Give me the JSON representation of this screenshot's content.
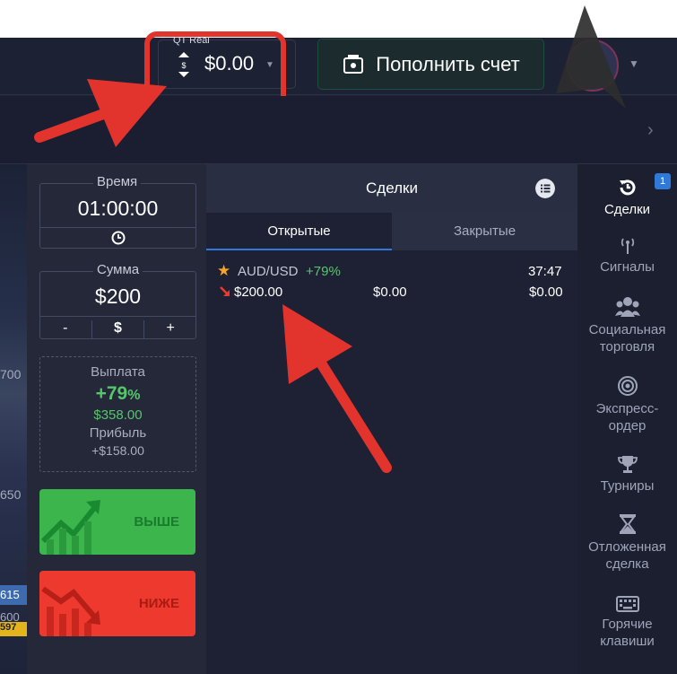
{
  "header": {
    "account_type": "QT Real",
    "balance": "$0.00",
    "deposit_label": "Пополнить счет"
  },
  "chart": {
    "price_labels": [
      "700",
      "650",
      "615",
      "600",
      "597"
    ]
  },
  "trade": {
    "time_label": "Время",
    "time_value": "01:00:00",
    "amount_label": "Сумма",
    "amount_value": "$200",
    "minus": "-",
    "currency": "$",
    "plus": "+",
    "payout_label": "Выплата",
    "payout_percent": "+79",
    "payout_percent_sign": "%",
    "payout_amount": "$358.00",
    "profit_label": "Прибыль",
    "profit_amount": "+$158.00",
    "up_label": "ВЫШЕ",
    "down_label": "НИЖЕ"
  },
  "deals": {
    "title": "Сделки",
    "tab_open": "Открытые",
    "tab_closed": "Закрытые",
    "items": [
      {
        "pair": "AUD/USD",
        "percent": "+79%",
        "time_left": "37:47",
        "amount": "$200.00",
        "value_mid": "$0.00",
        "value_right": "$0.00"
      }
    ]
  },
  "sidebar": {
    "badge": "1",
    "items": [
      {
        "label": "Сделки",
        "icon": "history-icon"
      },
      {
        "label": "Сигналы",
        "icon": "signal-icon"
      },
      {
        "label": "Социальная торговля",
        "icon": "users-icon"
      },
      {
        "label": "Экспресс-ордер",
        "icon": "target-icon"
      },
      {
        "label": "Турниры",
        "icon": "trophy-icon"
      },
      {
        "label": "Отложенная сделка",
        "icon": "hourglass-icon"
      },
      {
        "label": "Горячие клавиши",
        "icon": "keyboard-icon"
      }
    ]
  },
  "colors": {
    "up": "#3cb54d",
    "down": "#ee3a2e",
    "accent": "#2f7ad8",
    "annotation": "#e2332d"
  }
}
